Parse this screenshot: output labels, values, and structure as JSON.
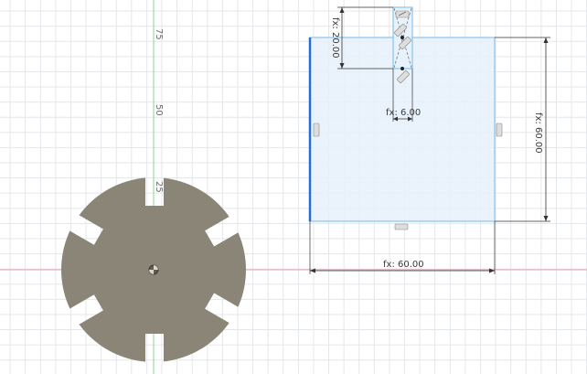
{
  "canvas": {
    "ruler_labels": [
      "75",
      "50",
      "25"
    ],
    "dimensions": {
      "small_height": "fx: 20.00",
      "small_width": "fx: 6.00",
      "square_height": "fx: 60.00",
      "square_width": "fx: 60.00"
    }
  },
  "colors": {
    "grid": "#e3e6ea",
    "x_axis": "#e6a0a8",
    "y_axis": "#8fd08f",
    "profile_fill": "#8a8577",
    "sketch_fill": "#e6f1fb",
    "sketch_edge": "#89c3ee",
    "selected_edge": "#1e6fdc",
    "dimension_line": "#333333"
  },
  "icons": {
    "origin": "origin-icon",
    "constraint": "midpoint-constraint-icon",
    "parallel": "parallel-constraint-icon"
  }
}
